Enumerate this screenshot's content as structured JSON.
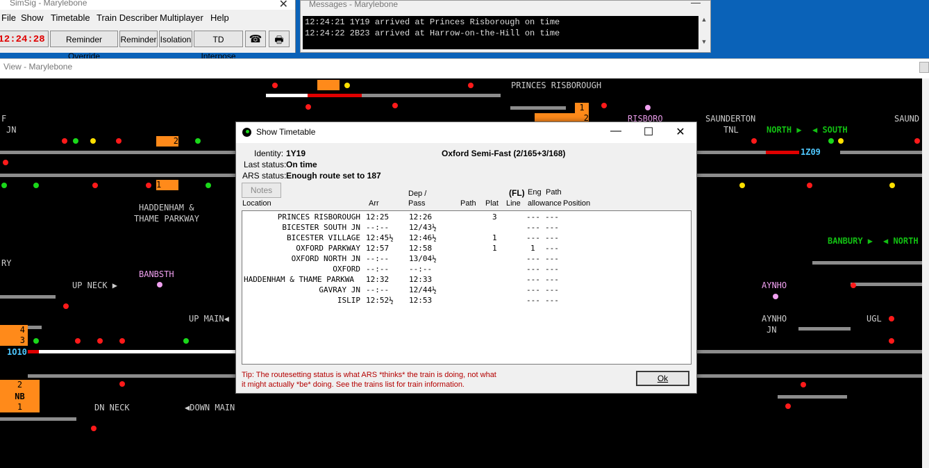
{
  "main_window": {
    "title": "SimSig - Marylebone",
    "close": "✕",
    "menu": [
      "File",
      "Show",
      "Timetable",
      "Train Describer",
      "Multiplayer",
      "Help"
    ],
    "clock": "12:24:28",
    "toolbar": {
      "reminder_override": "Reminder Override",
      "reminder": "Reminder",
      "isolation": "Isolation",
      "td_interpose": "TD Interpose",
      "phone_icon": "☎",
      "print_icon": "🖶"
    }
  },
  "messages_window": {
    "title": "Messages - Marylebone",
    "minimize": "—",
    "lines": [
      "12:24:21 1Y19 arrived at Princes Risborough on time",
      "12:24:22 2B23 arrived at Harrow-on-the-Hill on time"
    ],
    "scroll_up": "▲",
    "scroll_down": "▼"
  },
  "view_window": {
    "title": "View - Marylebone",
    "labels": {
      "princes_risborough": "PRINCES RISBOROUGH",
      "risboro": "RISBORO",
      "saunderton_tnl_1": "SAUNDERTON",
      "saunderton_tnl_2": "TNL",
      "saund": "SAUND",
      "north1": "NORTH ▶",
      "south1": "◀ SOUTH",
      "haddenham_1": "HADDENHAM &",
      "haddenham_2": "THAME PARKWAY",
      "banbsth": "BANBSTH",
      "up_neck": "UP NECK ▶",
      "up_main": "UP MAIN◀",
      "dn_neck": "DN NECK",
      "down_main": "◀DOWN MAIN",
      "banbury": "BANBURY ▶",
      "north2": "◀ NORTH",
      "aynho": "AYNHO",
      "aynho_jn_1": "AYNHO",
      "aynho_jn_2": "JN",
      "ugl": "UGL",
      "f": "F",
      "jn": "JN",
      "ry": "RY",
      "nb": "NB"
    },
    "berths": {
      "b_top": "",
      "b_1": "1",
      "b_2a": "2",
      "b_2b": "2",
      "b_1b": "1",
      "b_4": "4",
      "b_3": "3",
      "b_2c": "2",
      "b_1c": "1"
    },
    "train_ids": {
      "t1z09": "1Z09",
      "t1o10": "1O10"
    }
  },
  "dialog": {
    "title": "Show Timetable",
    "identity_label": "Identity:",
    "identity": "1Y19",
    "description": "Oxford Semi-Fast (2/165+3/168)",
    "last_status_label": "Last status:",
    "last_status": "On time",
    "ars_status_label": "ARS status:",
    "ars_status": "Enough route set to 187",
    "notes_button": "Notes",
    "columns": {
      "location": "Location",
      "arr": "Arr",
      "dep_1": "Dep /",
      "dep_2": "Pass",
      "path": "Path",
      "plat": "Plat",
      "fl": "(FL)",
      "line": "Line",
      "eng_1": "Eng",
      "eng_2": "allowance",
      "pathpos_1": "Path",
      "pathpos_2": "Position"
    },
    "rows": [
      {
        "location": "PRINCES RISBOROUGH",
        "arr": "12:25",
        "dep": "12:26",
        "plat": "3",
        "eng": "---",
        "pathpos": "---"
      },
      {
        "location": "BICESTER SOUTH JN",
        "arr": "--:--",
        "dep": "12/43½",
        "plat": "",
        "eng": "---",
        "pathpos": "---"
      },
      {
        "location": "BICESTER VILLAGE",
        "arr": "12:45½",
        "dep": "12:46½",
        "plat": "1",
        "eng": "---",
        "pathpos": "---"
      },
      {
        "location": "OXFORD PARKWAY",
        "arr": "12:57",
        "dep": "12:58",
        "plat": "1",
        "eng": "1",
        "pathpos": "---"
      },
      {
        "location": "OXFORD NORTH JN",
        "arr": "--:--",
        "dep": "13/04½",
        "plat": "",
        "eng": "---",
        "pathpos": "---"
      },
      {
        "location": "OXFORD",
        "arr": "--:--",
        "dep": "--:--",
        "plat": "",
        "eng": "---",
        "pathpos": "---"
      },
      {
        "location": "HADDENHAM & THAME PARKWA",
        "arr": "12:32",
        "dep": "12:33",
        "plat": "",
        "eng": "---",
        "pathpos": "---"
      },
      {
        "location": "GAVRAY JN",
        "arr": "--:--",
        "dep": "12/44½",
        "plat": "",
        "eng": "---",
        "pathpos": "---"
      },
      {
        "location": "ISLIP",
        "arr": "12:52½",
        "dep": "12:53",
        "plat": "",
        "eng": "---",
        "pathpos": "---"
      }
    ],
    "tip_1": "Tip: The routesetting status is what ARS *thinks* the train is doing, not what",
    "tip_2": "it might actually *be* doing. See the trains list for train information.",
    "ok_button": "Ok",
    "min_caption": "—",
    "max_caption": "☐",
    "close_caption": "✕"
  }
}
